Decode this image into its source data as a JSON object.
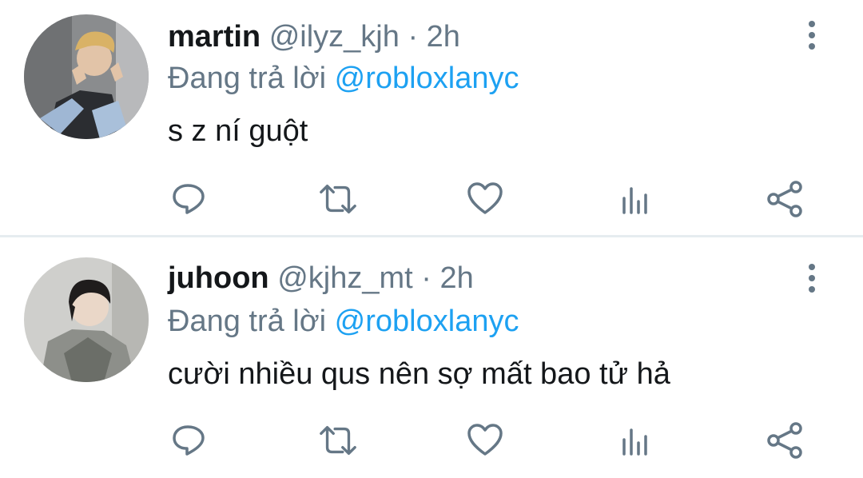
{
  "colors": {
    "primary_text": "#14171a",
    "secondary_text": "#657786",
    "accent_link": "#1da1f2",
    "divider": "#e6ecf0"
  },
  "tweets": [
    {
      "display_name": "martin",
      "handle": "@ilyz_kjh",
      "separator": "·",
      "time": "2h",
      "reply_prefix": "Đang trả lời",
      "reply_to": "@robloxlanyc",
      "text": "s z ní guột",
      "icons": [
        "more-vertical-icon",
        "reply-icon",
        "retweet-icon",
        "like-icon",
        "views-icon",
        "share-icon"
      ]
    },
    {
      "display_name": "juhoon",
      "handle": "@kjhz_mt",
      "separator": "·",
      "time": "2h",
      "reply_prefix": "Đang trả lời",
      "reply_to": "@robloxlanyc",
      "text": "cười nhiều qus nên sợ mất bao tử hả",
      "icons": [
        "more-vertical-icon",
        "reply-icon",
        "retweet-icon",
        "like-icon",
        "views-icon",
        "share-icon"
      ]
    }
  ]
}
